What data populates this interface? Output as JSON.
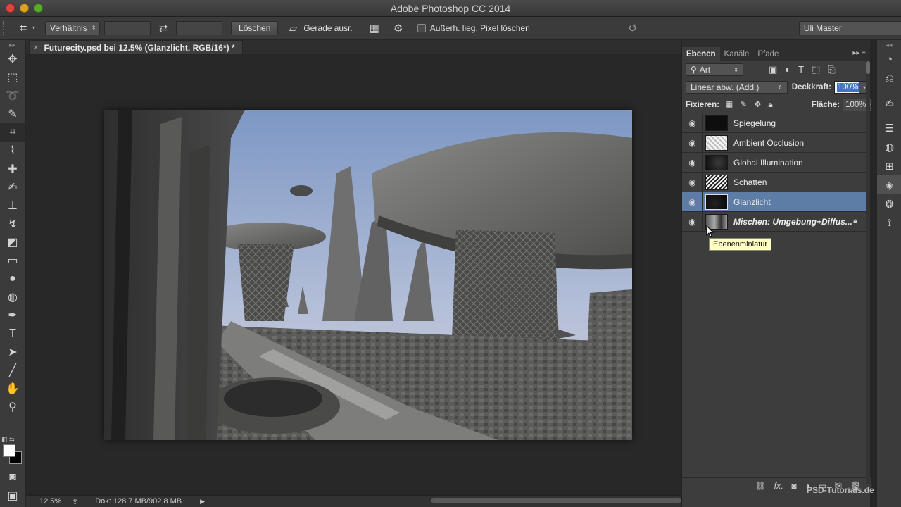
{
  "window": {
    "title": "Adobe Photoshop CC 2014"
  },
  "options_bar": {
    "ratio_select": "Verhältnis",
    "clear_button": "Löschen",
    "straighten_label": "Gerade ausr.",
    "delete_pixels_label": "Außerh. lieg. Pixel löschen",
    "workspace_select": "Uli Master"
  },
  "document": {
    "tab_close": "×",
    "tab_title": "Futurecity.psd bei 12.5% (Glanzlicht, RGB/16*) *"
  },
  "status_bar": {
    "zoom": "12.5%",
    "doc_size": "Dok: 128.7 MB/902.8 MB"
  },
  "layers_panel": {
    "tabs": [
      "Ebenen",
      "Kanäle",
      "Pfade"
    ],
    "filter_select": "Art",
    "blend_mode": "Linear abw. (Add.)",
    "opacity_label": "Deckkraft:",
    "opacity_value": "100%",
    "lock_label": "Fixieren:",
    "fill_label": "Fläche:",
    "fill_value": "100%",
    "layers": [
      {
        "name": "Spiegelung",
        "selected": false
      },
      {
        "name": "Ambient Occlusion",
        "selected": false
      },
      {
        "name": "Global Illumination",
        "selected": false
      },
      {
        "name": "Schatten",
        "selected": false
      },
      {
        "name": "Glanzlicht",
        "selected": true
      },
      {
        "name": "Mischen: Umgebung+Diffus...",
        "selected": false,
        "locked": true
      }
    ],
    "tooltip": "Ebenenminiatur"
  },
  "watermark": "PSD-Tutorials.de",
  "colors": {
    "selected_layer": "#5d7ca6",
    "panel_bg": "#3d3d3d",
    "canvas_bg": "#282828",
    "foreground": "#ffffff",
    "background": "#000000"
  }
}
